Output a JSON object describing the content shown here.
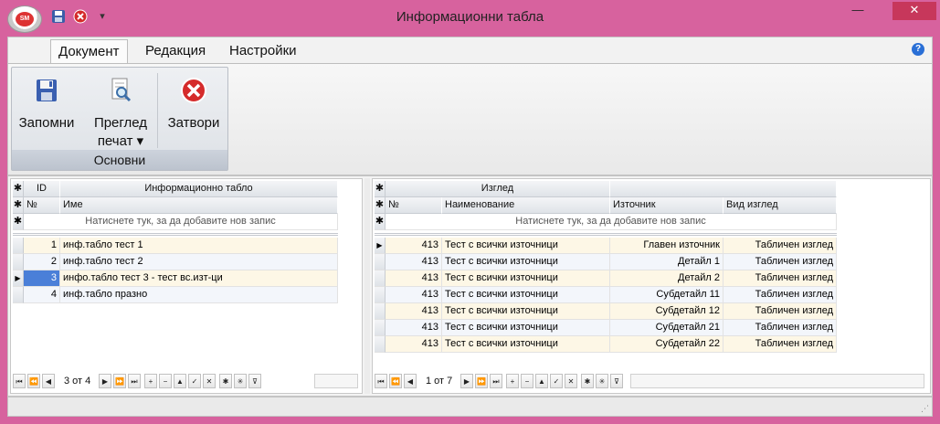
{
  "window": {
    "title": "Информационни табла",
    "app_orb_text": "SM",
    "minimize_glyph": "—",
    "close_glyph": "✕",
    "qat_dropdown_glyph": "▾"
  },
  "ribbon": {
    "tabs": [
      {
        "label": "Документ",
        "active": true
      },
      {
        "label": "Редакция",
        "active": false
      },
      {
        "label": "Настройки",
        "active": false
      }
    ],
    "help_glyph": "?",
    "group": {
      "label": "Основни",
      "buttons": [
        {
          "label": "Запомни",
          "icon": "save-icon"
        },
        {
          "label": "Преглед",
          "label2": "печат ▾",
          "icon": "print-preview-icon"
        },
        {
          "label": "Затвори",
          "icon": "close-icon"
        }
      ]
    }
  },
  "left_grid": {
    "header_row1": {
      "id": "ID",
      "title": "Информационно табло"
    },
    "header_row2": {
      "no": "№",
      "name": "Име"
    },
    "new_row_text": "Натиснете тук, за да добавите нов запис",
    "rows": [
      {
        "id": "1",
        "name": "инф.табло тест 1"
      },
      {
        "id": "2",
        "name": "инф.табло тест 2"
      },
      {
        "id": "3",
        "name": "инфо.табло тест 3 - тест вс.изт-ци",
        "current": true
      },
      {
        "id": "4",
        "name": "инф.табло празно"
      }
    ],
    "navigator": {
      "position": "3 от 4"
    }
  },
  "right_grid": {
    "header_row1": {
      "group": "Изглед"
    },
    "header_row2": {
      "no": "№",
      "name": "Наименование",
      "source": "Източник",
      "view": "Вид изглед"
    },
    "new_row_text": "Натиснете тук, за да добавите нов запис",
    "rows": [
      {
        "no": "413",
        "name": "Тест с всички източници",
        "source": "Главен източник",
        "view": "Табличен изглед",
        "current": true
      },
      {
        "no": "413",
        "name": "Тест с всички източници",
        "source": "Детайл 1",
        "view": "Табличен изглед"
      },
      {
        "no": "413",
        "name": "Тест с всички източници",
        "source": "Детайл 2",
        "view": "Табличен изглед"
      },
      {
        "no": "413",
        "name": "Тест с всички източници",
        "source": "Субдетайл 11",
        "view": "Табличен изглед"
      },
      {
        "no": "413",
        "name": "Тест с всички източници",
        "source": "Субдетайл 12",
        "view": "Табличен изглед"
      },
      {
        "no": "413",
        "name": "Тест с всички източници",
        "source": "Субдетайл 21",
        "view": "Табличен изглед"
      },
      {
        "no": "413",
        "name": "Тест с всички източници",
        "source": "Субдетайл 22",
        "view": "Табличен изглед"
      }
    ],
    "navigator": {
      "position": "1 от 7"
    }
  },
  "glyphs": {
    "row_indicator_current": "▶",
    "header_star": "✱"
  },
  "colors": {
    "window_frame": "#d7629e",
    "close_button": "#c7375b",
    "selected_cell": "#4a7fd8"
  }
}
